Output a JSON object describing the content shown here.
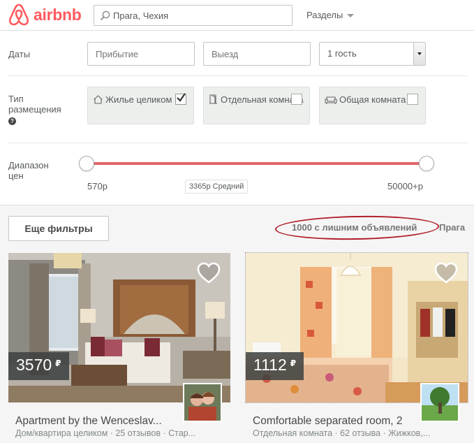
{
  "header": {
    "logo_text": "airbnb",
    "search_value": "Прага, Чехия",
    "sections_label": "Разделы"
  },
  "filters": {
    "dates_label": "Даты",
    "checkin_placeholder": "Прибытие",
    "checkout_placeholder": "Выезд",
    "guests_value": "1 гость",
    "room_type_label": "Тип размещения",
    "room_types": [
      {
        "label": "Жилье целиком",
        "checked": true
      },
      {
        "label": "Отдельная комната",
        "checked": false
      },
      {
        "label": "Общая комната",
        "checked": false
      }
    ],
    "price_range_label": "Диапазон цен",
    "price_min": "570р",
    "price_max": "50000+р",
    "price_avg": "3365р Средний"
  },
  "results": {
    "more_filters_label": "Еще фильтры",
    "count_text": "1000 с лишним объявлений",
    "city": "Прага",
    "listings": [
      {
        "price": "3570",
        "currency": "₽",
        "title": "Apartment by the Wenceslav...",
        "subtitle": "Дом/квартира целиком · 25 отзывов · Стар..."
      },
      {
        "price": "1112",
        "currency": "₽",
        "title": "Comfortable separated room, 2",
        "subtitle": "Отдельная комната · 62 отзыва · Жижков,..."
      }
    ]
  },
  "colors": {
    "brand": "#ff5a5f",
    "slider": "#e0666a",
    "annotation": "#b01e2a"
  }
}
